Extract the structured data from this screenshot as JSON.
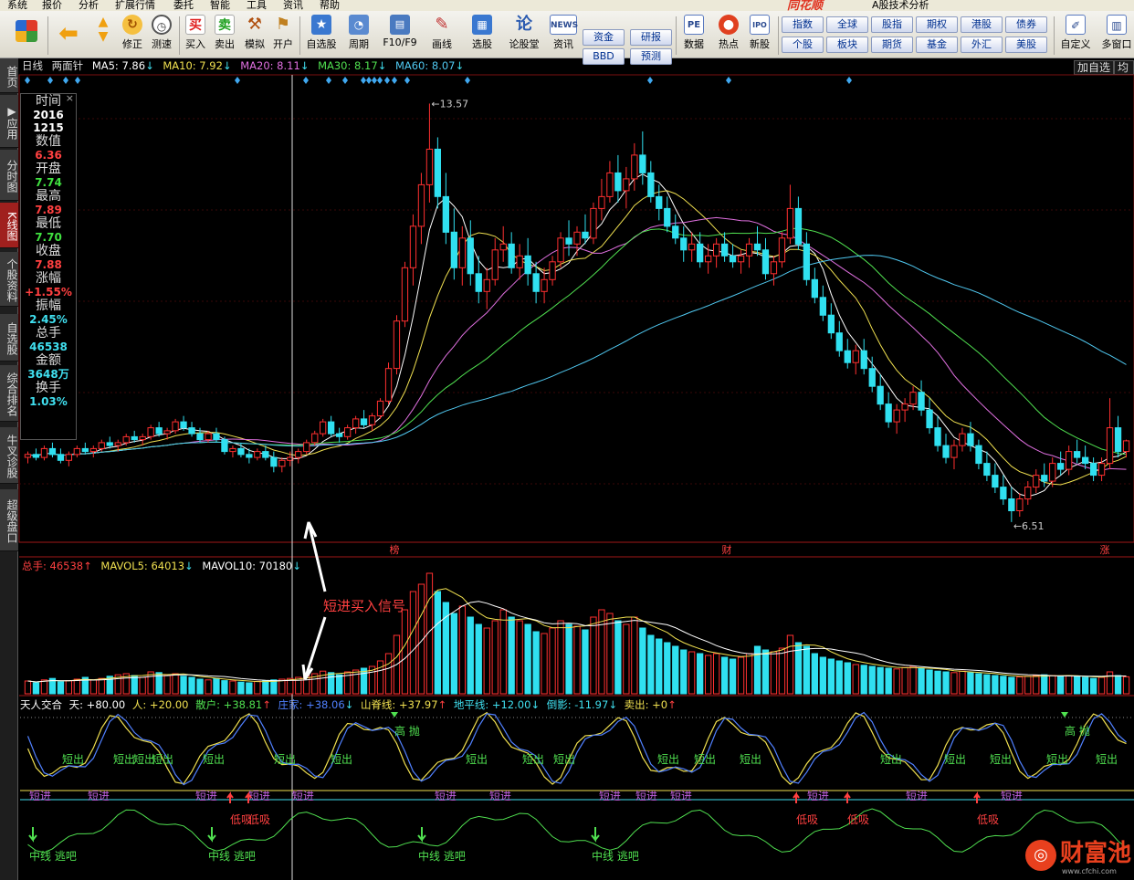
{
  "menu": {
    "items": [
      "系统",
      "报价",
      "分析",
      "扩展行情",
      "委托",
      "智能",
      "工具",
      "资讯",
      "帮助"
    ],
    "brand": "同花顺",
    "app_title": "A股技术分析"
  },
  "toolbar": {
    "buttons": [
      {
        "label": "修正",
        "icon": "refresh-icon"
      },
      {
        "label": "测速",
        "icon": "clock-icon"
      },
      {
        "label": "买入",
        "icon": "buy-icon",
        "glyph": "买"
      },
      {
        "label": "卖出",
        "icon": "sell-icon",
        "glyph": "卖"
      },
      {
        "label": "模拟",
        "icon": "hammer-icon"
      },
      {
        "label": "开户",
        "icon": "account-icon"
      },
      {
        "label": "自选股",
        "icon": "star-icon"
      },
      {
        "label": "周期",
        "icon": "period-icon"
      },
      {
        "label": "F10/F9",
        "icon": "f10-icon"
      },
      {
        "label": "画线",
        "icon": "pen-icon"
      },
      {
        "label": "选股",
        "icon": "screen-icon"
      },
      {
        "label": "论股堂",
        "icon": "forum-icon",
        "glyph": "论"
      },
      {
        "label": "资讯",
        "icon": "news-icon",
        "glyph": "NEWS"
      },
      {
        "label": "数据",
        "icon": "pe-icon",
        "glyph": "PE"
      },
      {
        "label": "热点",
        "icon": "hot-icon"
      },
      {
        "label": "新股",
        "icon": "ipo-icon",
        "glyph": "IPO"
      },
      {
        "label": "自定义",
        "icon": "custom-icon"
      },
      {
        "label": "多窗口",
        "icon": "window-icon"
      }
    ],
    "mini_buttons": [
      "资金",
      "研报",
      "BBD",
      "预测"
    ],
    "market_buttons": [
      "指数",
      "全球",
      "股指",
      "期权",
      "港股",
      "债券",
      "个股",
      "板块",
      "期货",
      "基金",
      "外汇",
      "美股"
    ]
  },
  "sidebar": {
    "tabs": [
      "首页",
      "应用",
      "分时图",
      "K线图",
      "个股资料",
      "自选股",
      "综合排名",
      "牛叉诊股",
      "超级盘口"
    ],
    "active": "K线图"
  },
  "chart_header": {
    "period": "日线",
    "mode": "两面针",
    "ma": [
      {
        "label": "MA5: 7.86",
        "color": "#ffffff"
      },
      {
        "label": "MA10: 7.92",
        "color": "#f0e050"
      },
      {
        "label": "MA20: 8.11",
        "color": "#e070e0"
      },
      {
        "label": "MA30: 8.17",
        "color": "#50e050"
      },
      {
        "label": "MA60: 8.07",
        "color": "#50c8f0"
      }
    ],
    "add_self": "加自选",
    "avg_line": "均线"
  },
  "info_box": {
    "rows": [
      {
        "k": "时间",
        "v": "2016",
        "color": "#ffffff"
      },
      {
        "k": "",
        "v": "1215",
        "color": "#ffffff"
      },
      {
        "k": "数值",
        "v": "6.36",
        "color": "#ff4040"
      },
      {
        "k": "开盘",
        "v": "7.74",
        "color": "#40e040"
      },
      {
        "k": "最高",
        "v": "7.89",
        "color": "#ff4040"
      },
      {
        "k": "最低",
        "v": "7.70",
        "color": "#40e040"
      },
      {
        "k": "收盘",
        "v": "7.88",
        "color": "#ff4040"
      },
      {
        "k": "涨幅",
        "v": "+1.55%",
        "color": "#ff4040"
      },
      {
        "k": "振幅",
        "v": "2.45%",
        "color": "#40e0f0"
      },
      {
        "k": "总手",
        "v": "46538",
        "color": "#40e0f0"
      },
      {
        "k": "金额",
        "v": "3648万",
        "color": "#40e0f0"
      },
      {
        "k": "换手",
        "v": "1.03%",
        "color": "#40e0f0"
      }
    ]
  },
  "price_labels": {
    "high": "13.57",
    "low": "6.51"
  },
  "event_tags": [
    "榜",
    "财",
    "涨"
  ],
  "volume_header": {
    "total": "总手: 46538",
    "mavol5": "MAVOL5: 64013",
    "mavol10": "MAVOL10: 70180"
  },
  "annotation": "短进买入信号",
  "indicator_header": {
    "name": "天人交合",
    "items": [
      {
        "label": "天: +80.00",
        "color": "#ffffff"
      },
      {
        "label": "人: +20.00",
        "color": "#f0e050"
      },
      {
        "label": "散户: +38.81",
        "color": "#50e050"
      },
      {
        "label": "庄家: +38.06",
        "color": "#5080ff"
      },
      {
        "label": "山脊线: +37.97",
        "color": "#f0e050"
      },
      {
        "label": "地平线: +12.00",
        "color": "#40e0f0"
      },
      {
        "label": "倒影: -11.97",
        "color": "#40e0f0"
      },
      {
        "label": "卖出: +0",
        "color": "#f0e050"
      }
    ]
  },
  "signals": {
    "short_out": "短出",
    "short_in": "短进",
    "high_sell": "高 抛",
    "low_buy": "低吸",
    "midline_escape": "中线 逃吧"
  },
  "watermark": {
    "text": "财富池",
    "url": "www.cfchi.com"
  },
  "chart_data": {
    "type": "candlestick",
    "price_axis_extremes": {
      "high": 13.57,
      "low": 6.51
    },
    "ohlc": [
      [
        7.6,
        7.7,
        7.5,
        7.65
      ],
      [
        7.65,
        7.75,
        7.55,
        7.6
      ],
      [
        7.6,
        7.8,
        7.55,
        7.75
      ],
      [
        7.75,
        7.85,
        7.6,
        7.65
      ],
      [
        7.65,
        7.75,
        7.5,
        7.55
      ],
      [
        7.55,
        7.7,
        7.45,
        7.65
      ],
      [
        7.65,
        7.8,
        7.6,
        7.75
      ],
      [
        7.75,
        7.85,
        7.65,
        7.7
      ],
      [
        7.7,
        7.8,
        7.6,
        7.75
      ],
      [
        7.75,
        7.9,
        7.7,
        7.85
      ],
      [
        7.85,
        7.95,
        7.75,
        7.8
      ],
      [
        7.8,
        7.9,
        7.7,
        7.85
      ],
      [
        7.85,
        8.0,
        7.8,
        7.95
      ],
      [
        7.95,
        8.05,
        7.85,
        7.9
      ],
      [
        7.9,
        8.0,
        7.8,
        7.95
      ],
      [
        7.95,
        8.15,
        7.9,
        8.1
      ],
      [
        8.1,
        8.2,
        7.95,
        8.0
      ],
      [
        8.0,
        8.1,
        7.9,
        8.05
      ],
      [
        8.05,
        8.25,
        8.0,
        8.2
      ],
      [
        8.2,
        8.3,
        8.05,
        8.1
      ],
      [
        8.1,
        8.2,
        7.95,
        8.0
      ],
      [
        8.0,
        8.1,
        7.85,
        7.9
      ],
      [
        7.9,
        8.05,
        7.85,
        8.0
      ],
      [
        8.0,
        8.1,
        7.85,
        7.9
      ],
      [
        7.9,
        7.95,
        7.65,
        7.7
      ],
      [
        7.7,
        7.8,
        7.6,
        7.75
      ],
      [
        7.75,
        7.85,
        7.6,
        7.65
      ],
      [
        7.65,
        7.75,
        7.5,
        7.6
      ],
      [
        7.6,
        7.75,
        7.55,
        7.7
      ],
      [
        7.7,
        7.8,
        7.55,
        7.6
      ],
      [
        7.6,
        7.7,
        7.35,
        7.45
      ],
      [
        7.45,
        7.6,
        7.35,
        7.55
      ],
      [
        7.55,
        7.7,
        7.45,
        7.6
      ],
      [
        7.6,
        7.75,
        7.5,
        7.7
      ],
      [
        7.7,
        7.9,
        7.65,
        7.85
      ],
      [
        7.85,
        8.05,
        7.8,
        8.0
      ],
      [
        8.0,
        8.25,
        7.95,
        8.2
      ],
      [
        8.2,
        8.3,
        7.95,
        8.0
      ],
      [
        8.0,
        8.1,
        7.85,
        7.95
      ],
      [
        7.95,
        8.15,
        7.9,
        8.1
      ],
      [
        8.1,
        8.3,
        8.0,
        8.25
      ],
      [
        8.25,
        8.4,
        8.1,
        8.15
      ],
      [
        8.15,
        8.35,
        8.05,
        8.3
      ],
      [
        8.3,
        8.6,
        8.25,
        8.55
      ],
      [
        8.55,
        9.2,
        8.5,
        9.1
      ],
      [
        9.1,
        10.0,
        9.0,
        9.9
      ],
      [
        9.9,
        10.9,
        9.8,
        10.8
      ],
      [
        10.8,
        11.7,
        10.5,
        11.5
      ],
      [
        11.5,
        12.4,
        11.2,
        12.2
      ],
      [
        12.2,
        13.57,
        11.9,
        12.8
      ],
      [
        12.8,
        13.0,
        11.8,
        12.0
      ],
      [
        12.0,
        12.4,
        11.2,
        11.4
      ],
      [
        11.4,
        11.8,
        10.6,
        10.8
      ],
      [
        10.8,
        11.5,
        10.5,
        11.3
      ],
      [
        11.3,
        11.6,
        10.5,
        10.7
      ],
      [
        10.7,
        11.0,
        10.2,
        10.4
      ],
      [
        10.4,
        10.8,
        10.1,
        10.6
      ],
      [
        10.6,
        11.3,
        10.5,
        11.1
      ],
      [
        11.1,
        11.5,
        10.9,
        11.2
      ],
      [
        11.2,
        11.4,
        10.7,
        10.8
      ],
      [
        10.8,
        11.2,
        10.6,
        11.0
      ],
      [
        11.0,
        11.3,
        10.5,
        10.7
      ],
      [
        10.7,
        10.9,
        10.2,
        10.4
      ],
      [
        10.4,
        10.8,
        10.2,
        10.6
      ],
      [
        10.6,
        11.0,
        10.5,
        10.9
      ],
      [
        10.9,
        11.4,
        10.8,
        11.3
      ],
      [
        11.3,
        11.6,
        11.0,
        11.2
      ],
      [
        11.2,
        11.5,
        11.0,
        11.4
      ],
      [
        11.4,
        11.7,
        11.2,
        11.3
      ],
      [
        11.3,
        11.9,
        11.2,
        11.8
      ],
      [
        11.8,
        12.3,
        11.6,
        12.0
      ],
      [
        12.0,
        12.6,
        11.9,
        12.4
      ],
      [
        12.4,
        12.7,
        11.9,
        12.1
      ],
      [
        12.1,
        12.5,
        11.8,
        12.3
      ],
      [
        12.3,
        12.9,
        12.1,
        12.7
      ],
      [
        12.7,
        13.1,
        12.2,
        12.4
      ],
      [
        12.4,
        12.6,
        11.9,
        12.0
      ],
      [
        12.0,
        12.2,
        11.6,
        11.8
      ],
      [
        11.8,
        12.0,
        11.4,
        11.5
      ],
      [
        11.5,
        11.7,
        11.2,
        11.3
      ],
      [
        11.3,
        11.5,
        10.9,
        11.1
      ],
      [
        11.1,
        11.4,
        10.9,
        11.2
      ],
      [
        11.2,
        11.4,
        10.8,
        10.9
      ],
      [
        10.9,
        11.2,
        10.7,
        11.0
      ],
      [
        11.0,
        11.3,
        10.8,
        11.2
      ],
      [
        11.2,
        11.4,
        10.9,
        11.0
      ],
      [
        11.0,
        11.2,
        10.8,
        10.9
      ],
      [
        10.9,
        11.1,
        10.7,
        11.0
      ],
      [
        11.0,
        11.3,
        10.8,
        11.2
      ],
      [
        11.2,
        11.5,
        11.0,
        11.1
      ],
      [
        11.1,
        11.3,
        10.6,
        10.7
      ],
      [
        10.7,
        11.0,
        10.5,
        10.9
      ],
      [
        10.9,
        11.4,
        10.8,
        11.3
      ],
      [
        11.3,
        12.2,
        11.2,
        11.8
      ],
      [
        11.8,
        12.0,
        11.1,
        11.2
      ],
      [
        11.2,
        11.4,
        10.5,
        10.6
      ],
      [
        10.6,
        10.8,
        10.2,
        10.3
      ],
      [
        10.3,
        10.5,
        9.9,
        10.0
      ],
      [
        10.0,
        10.2,
        9.6,
        9.7
      ],
      [
        9.7,
        9.9,
        9.3,
        9.4
      ],
      [
        9.4,
        9.6,
        9.1,
        9.2
      ],
      [
        9.2,
        9.5,
        9.0,
        9.4
      ],
      [
        9.4,
        9.6,
        9.0,
        9.1
      ],
      [
        9.1,
        9.3,
        8.7,
        8.8
      ],
      [
        8.8,
        9.0,
        8.4,
        8.5
      ],
      [
        8.5,
        8.7,
        8.1,
        8.2
      ],
      [
        8.2,
        8.5,
        8.0,
        8.4
      ],
      [
        8.4,
        8.6,
        8.2,
        8.5
      ],
      [
        8.5,
        8.8,
        8.4,
        8.7
      ],
      [
        8.7,
        8.9,
        8.3,
        8.4
      ],
      [
        8.4,
        8.6,
        8.0,
        8.1
      ],
      [
        8.1,
        8.3,
        7.7,
        7.8
      ],
      [
        7.8,
        8.0,
        7.5,
        7.6
      ],
      [
        7.6,
        7.9,
        7.4,
        7.8
      ],
      [
        7.8,
        8.1,
        7.7,
        8.0
      ],
      [
        8.0,
        8.2,
        7.7,
        7.8
      ],
      [
        7.8,
        7.9,
        7.4,
        7.5
      ],
      [
        7.5,
        7.7,
        7.2,
        7.3
      ],
      [
        7.3,
        7.5,
        7.0,
        7.1
      ],
      [
        7.1,
        7.3,
        6.8,
        6.9
      ],
      [
        6.9,
        7.1,
        6.51,
        6.7
      ],
      [
        6.7,
        7.0,
        6.6,
        6.9
      ],
      [
        6.9,
        7.2,
        6.8,
        7.1
      ],
      [
        7.1,
        7.4,
        7.0,
        7.3
      ],
      [
        7.3,
        7.5,
        7.1,
        7.2
      ],
      [
        7.2,
        7.6,
        7.1,
        7.5
      ],
      [
        7.5,
        7.7,
        7.3,
        7.4
      ],
      [
        7.4,
        7.8,
        7.3,
        7.7
      ],
      [
        7.7,
        7.9,
        7.5,
        7.6
      ],
      [
        7.6,
        7.8,
        7.4,
        7.5
      ],
      [
        7.5,
        7.6,
        7.2,
        7.3
      ],
      [
        7.3,
        7.6,
        7.2,
        7.5
      ],
      [
        7.5,
        8.6,
        7.4,
        8.1
      ],
      [
        8.1,
        8.3,
        7.6,
        7.7
      ],
      [
        7.7,
        7.9,
        7.6,
        7.88
      ]
    ],
    "volume": [
      35,
      30,
      38,
      42,
      33,
      36,
      40,
      45,
      38,
      42,
      48,
      52,
      55,
      50,
      45,
      60,
      58,
      50,
      55,
      48,
      45,
      40,
      38,
      42,
      36,
      35,
      32,
      30,
      34,
      36,
      38,
      40,
      42,
      45,
      50,
      55,
      62,
      58,
      52,
      60,
      65,
      70,
      75,
      90,
      110,
      160,
      230,
      280,
      300,
      330,
      280,
      250,
      220,
      240,
      210,
      190,
      180,
      200,
      230,
      210,
      200,
      190,
      170,
      165,
      180,
      200,
      190,
      185,
      175,
      210,
      230,
      220,
      200,
      190,
      210,
      180,
      160,
      150,
      140,
      130,
      120,
      115,
      110,
      105,
      110,
      100,
      95,
      100,
      110,
      130,
      120,
      115,
      125,
      160,
      140,
      130,
      110,
      100,
      95,
      90,
      85,
      80,
      78,
      75,
      72,
      70,
      68,
      72,
      75,
      70,
      65,
      62,
      60,
      58,
      62,
      58,
      55,
      52,
      50,
      48,
      45,
      46,
      48,
      50,
      52,
      50,
      48,
      50,
      48,
      45,
      42,
      45,
      60,
      50,
      46.5
    ],
    "mavol": {
      "MAVOL5": 64013,
      "MAVOL10": 70180
    }
  }
}
